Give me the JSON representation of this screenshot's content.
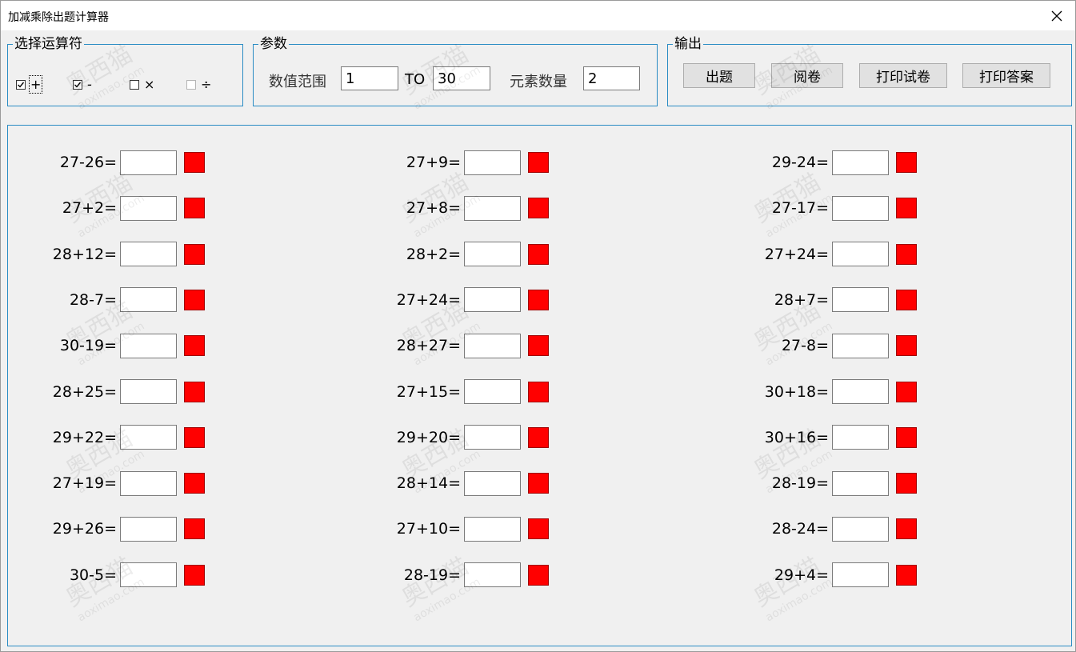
{
  "window": {
    "title": "加减乘除出题计算器"
  },
  "operators": {
    "legend": "选择运算符",
    "items": [
      {
        "symbol": "+",
        "checked": true,
        "enabled": true
      },
      {
        "symbol": "-",
        "checked": true,
        "enabled": true
      },
      {
        "symbol": "×",
        "checked": false,
        "enabled": true
      },
      {
        "symbol": "÷",
        "checked": false,
        "enabled": false
      }
    ]
  },
  "params": {
    "legend": "参数",
    "range_label": "数值范围",
    "range_from": "1",
    "to_label": "TO",
    "range_to": "30",
    "count_label": "元素数量",
    "count": "2"
  },
  "output": {
    "legend": "输出",
    "generate": "出题",
    "grade": "阅卷",
    "print_test": "打印试卷",
    "print_answers": "打印答案"
  },
  "questions": {
    "col1": [
      "27-26=",
      "27+2=",
      "28+12=",
      "28-7=",
      "30-19=",
      "28+25=",
      "29+22=",
      "27+19=",
      "29+26=",
      "30-5="
    ],
    "col2": [
      "27+9=",
      "27+8=",
      "28+2=",
      "27+24=",
      "28+27=",
      "27+15=",
      "29+20=",
      "28+14=",
      "27+10=",
      "28-19="
    ],
    "col3": [
      "29-24=",
      "27-17=",
      "27+24=",
      "28+7=",
      "27-8=",
      "30+18=",
      "30+16=",
      "28-19=",
      "28-24=",
      "29+4="
    ]
  },
  "colors": {
    "border": "#2a8cc4",
    "status": "#ff0000",
    "background": "#f0f0f0"
  },
  "watermark": {
    "text_cn": "奥西猫",
    "text_en": "aoximao.com"
  }
}
